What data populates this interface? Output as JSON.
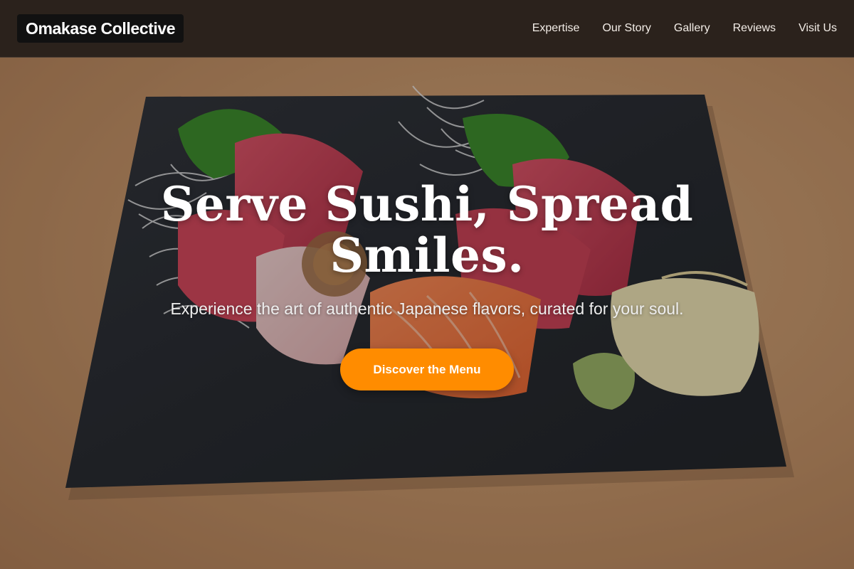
{
  "header": {
    "brand": "Omakase Collective",
    "nav": [
      "Expertise",
      "Our Story",
      "Gallery",
      "Reviews",
      "Visit Us"
    ]
  },
  "hero": {
    "title": "Serve Sushi, Spread Smiles.",
    "subtitle": "Experience the art of authentic Japanese flavors, curated for your soul.",
    "cta_label": "Discover the Menu",
    "cta_color": "#ff8c00",
    "background_image": "sashimi-platter-on-slate"
  },
  "colors": {
    "header_bg": "#2b221c",
    "brand_bg": "#111111",
    "accent": "#ff8c00",
    "table_wood": "#c99a6f",
    "slate": "#2a2d33"
  }
}
